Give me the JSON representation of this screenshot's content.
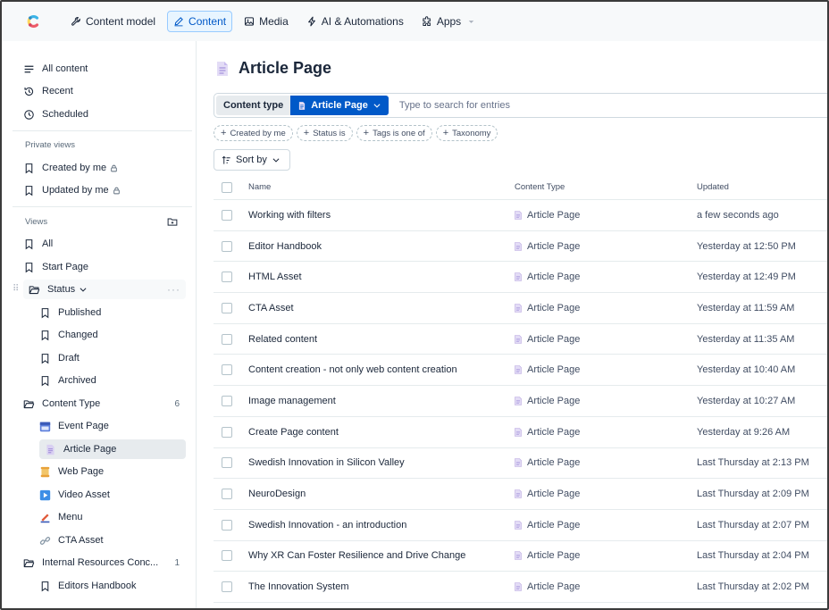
{
  "topnav": {
    "items": [
      {
        "label": "Content model",
        "icon": "wrench-icon"
      },
      {
        "label": "Content",
        "icon": "pen-icon",
        "active": true
      },
      {
        "label": "Media",
        "icon": "image-icon"
      },
      {
        "label": "AI & Automations",
        "icon": "bolt-icon"
      },
      {
        "label": "Apps",
        "icon": "puzzle-icon"
      }
    ]
  },
  "sidebar": {
    "top": [
      {
        "label": "All content",
        "icon": "list-icon"
      },
      {
        "label": "Recent",
        "icon": "history-icon"
      },
      {
        "label": "Scheduled",
        "icon": "clock-icon"
      }
    ],
    "private_views_title": "Private views",
    "private_views": [
      {
        "label": "Created by me",
        "icon": "bookmark-icon"
      },
      {
        "label": "Updated by me",
        "icon": "bookmark-icon"
      }
    ],
    "views_title": "Views",
    "views": [
      {
        "label": "All"
      },
      {
        "label": "Start Page"
      }
    ],
    "status_folder": "Status",
    "status_items": [
      "Published",
      "Changed",
      "Draft",
      "Archived"
    ],
    "content_type_folder": "Content Type",
    "content_type_count": "6",
    "content_types": [
      {
        "label": "Event Page",
        "color": "#5b7ddb"
      },
      {
        "label": "Article Page",
        "color": "#b9a8e0"
      },
      {
        "label": "Web Page",
        "color": "#e8a23a"
      },
      {
        "label": "Video Asset",
        "color": "#3d8ee6"
      },
      {
        "label": "Menu",
        "color": "#e05a3a"
      },
      {
        "label": "CTA Asset",
        "color": "#8a9aa8"
      }
    ],
    "internal_folder": "Internal Resources Conc...",
    "internal_count": "1",
    "internal_items": [
      "Editors Handbook"
    ]
  },
  "main": {
    "title": "Article Page",
    "search": {
      "chip_label": "Content type",
      "chip_value": "Article Page",
      "placeholder": "Type to search for entries"
    },
    "filters": [
      "Created by me",
      "Status is",
      "Tags is one of",
      "Taxonomy"
    ],
    "sort_label": "Sort by",
    "columns": {
      "name": "Name",
      "type": "Content Type",
      "updated": "Updated"
    },
    "rows": [
      {
        "name": "Working with filters",
        "type": "Article Page",
        "updated": "a few seconds ago"
      },
      {
        "name": "Editor Handbook",
        "type": "Article Page",
        "updated": "Yesterday at 12:50 PM"
      },
      {
        "name": "HTML Asset",
        "type": "Article Page",
        "updated": "Yesterday at 12:49 PM"
      },
      {
        "name": "CTA Asset",
        "type": "Article Page",
        "updated": "Yesterday at 11:59 AM"
      },
      {
        "name": "Related content",
        "type": "Article Page",
        "updated": "Yesterday at 11:35 AM"
      },
      {
        "name": "Content creation - not only web content creation",
        "type": "Article Page",
        "updated": "Yesterday at 10:40 AM"
      },
      {
        "name": "Image management",
        "type": "Article Page",
        "updated": "Yesterday at 10:27 AM"
      },
      {
        "name": "Create Page content",
        "type": "Article Page",
        "updated": "Yesterday at 9:26 AM"
      },
      {
        "name": "Swedish Innovation in Silicon Valley",
        "type": "Article Page",
        "updated": "Last Thursday at 2:13 PM"
      },
      {
        "name": "NeuroDesign",
        "type": "Article Page",
        "updated": "Last Thursday at 2:09 PM"
      },
      {
        "name": "Swedish Innovation - an introduction",
        "type": "Article Page",
        "updated": "Last Thursday at 2:07 PM"
      },
      {
        "name": "Why XR Can Foster Resilience and Drive Change",
        "type": "Article Page",
        "updated": "Last Thursday at 2:04 PM"
      },
      {
        "name": "The Innovation System",
        "type": "Article Page",
        "updated": "Last Thursday at 2:02 PM"
      }
    ]
  },
  "colors": {
    "accent": "#0059c8",
    "accent_light": "#e8f5ff",
    "text": "#1b273a",
    "muted": "#5a6a7a",
    "border": "#e5ebed"
  }
}
